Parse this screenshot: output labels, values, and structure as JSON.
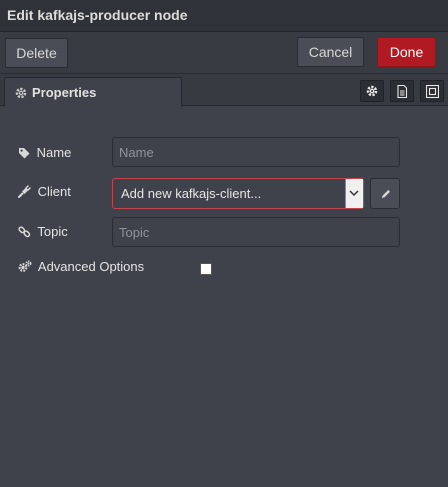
{
  "dialog": {
    "title": "Edit kafkajs-producer node"
  },
  "toolbar": {
    "delete_label": "Delete",
    "cancel_label": "Cancel",
    "done_label": "Done"
  },
  "tabs": [
    {
      "label": "Properties",
      "icon": "gear-icon",
      "active": true
    }
  ],
  "tab_icons": [
    "gear-icon",
    "document-icon",
    "frame-icon"
  ],
  "form": {
    "name": {
      "label": "Name",
      "icon": "tag-icon",
      "value": "",
      "placeholder": "Name"
    },
    "client": {
      "label": "Client",
      "icon": "plug-icon",
      "selected": "Add new kafkajs-client...",
      "edit_icon": "pencil-icon"
    },
    "topic": {
      "label": "Topic",
      "icon": "link-icon",
      "value": "",
      "placeholder": "Topic"
    },
    "advanced": {
      "label": "Advanced Options",
      "icon": "gears-icon",
      "checked": false
    }
  },
  "colors": {
    "background": "#3f424b",
    "done_button": "#b11a22",
    "invalid_border": "#c2454b"
  }
}
